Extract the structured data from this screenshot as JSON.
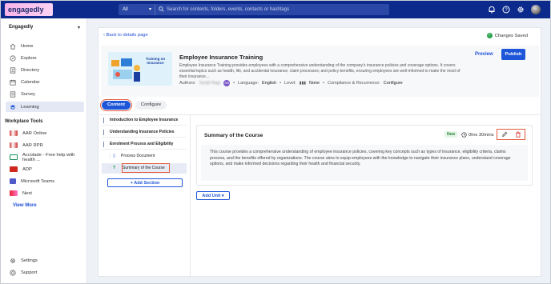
{
  "topbar": {
    "logo_text": "engagedly",
    "search_scope": "All",
    "search_placeholder": "Search for contents, folders, events, contacts or hashtags"
  },
  "sidebar": {
    "org": "Engagedly",
    "nav": [
      {
        "label": "Home",
        "icon": "home-icon"
      },
      {
        "label": "Explore",
        "icon": "compass-icon"
      },
      {
        "label": "Directory",
        "icon": "directory-icon"
      },
      {
        "label": "Calendar",
        "icon": "calendar-icon"
      },
      {
        "label": "Survey",
        "icon": "survey-icon"
      },
      {
        "label": "Learning",
        "icon": "learning-icon",
        "active": true
      }
    ],
    "tools_title": "Workplace Tools",
    "tools": [
      {
        "label": "AAR Online"
      },
      {
        "label": "AAR RPR"
      },
      {
        "label": "Accolade - Free help with health ..."
      },
      {
        "label": "ADP"
      },
      {
        "label": "Microsoft Teams"
      },
      {
        "label": "Next"
      }
    ],
    "view_more": "View More",
    "settings": "Settings",
    "support": "Support"
  },
  "main": {
    "back": "Back to details page",
    "saved": "Changes Saved",
    "course": {
      "thumb_text": "Training on Insurance",
      "title": "Employee Insurance Training",
      "description": "Employee Insurance Training provides employees with a comprehensive understanding of the company's insurance policies and coverage options. It covers essential topics such as health, life, and accidental insurance; claim processes; and policy benefits, ensuring employees are well-informed to make the most of their insurance...",
      "authors_label": "Authors:",
      "author_name": "Sanjit Nagi",
      "language_label": "Language:",
      "language": "English",
      "level_label": "Level:",
      "level": "None",
      "compliance_label": "Compliance & Recurrence:",
      "compliance": "Configure",
      "preview": "Preview",
      "publish": "Publish"
    },
    "tabs": [
      "Content",
      "Configure"
    ],
    "outline": [
      {
        "label": "Introduction to Employee Insurance"
      },
      {
        "label": "Understanding Insurance Policies"
      },
      {
        "label": "Enrolment Process and Eligibility"
      }
    ],
    "sub_items": [
      {
        "label": "Process Document"
      },
      {
        "label": "Summary of the Course"
      }
    ],
    "add_section": "+ Add Section",
    "unit": {
      "title": "Summary of the Course",
      "badge": "New",
      "duration": "0hrs 30mins",
      "body": "This course provides a comprehensive understanding of employee insurance policies, covering key concepts such as types of insurance, eligibility criteria, claims process, and the benefits offered by organizations. The course aims to equip employees with the knowledge to navigate their insurance plans, understand coverage options, and make informed decisions regarding their health and financial security."
    },
    "add_unit": "Add Unit"
  },
  "colors": {
    "brand": "#0b2a8c",
    "accent": "#1d56d8",
    "highlight": "#e25b3b"
  }
}
